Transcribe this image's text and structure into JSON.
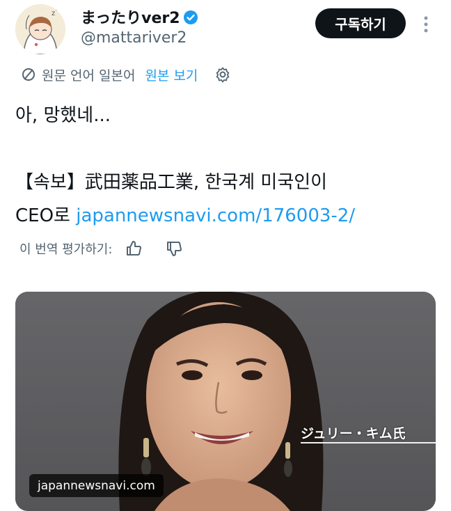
{
  "author": {
    "display_name": "まったりver2",
    "handle": "@mattariver2",
    "verified_icon": "verified-badge-icon",
    "subscribe_label": "구독하기"
  },
  "translation": {
    "notice": "원문 언어 일본어",
    "show_original": "원본 보기"
  },
  "tweet": {
    "line1": "아, 망했네...",
    "line2": "【속보】武田薬品工業, 한국계 미국인이",
    "line3_prefix": "CEO로 ",
    "link": "japannewsnavi.com/176003-2/"
  },
  "rating": {
    "label": "이 번역 평가하기:"
  },
  "media": {
    "caption": "ジュリー・キム氏",
    "source": "japannewsnavi.com"
  },
  "colors": {
    "accent": "#1d9bf0",
    "text": "#0f1419",
    "muted": "#536471",
    "button_bg": "#0f1419"
  }
}
